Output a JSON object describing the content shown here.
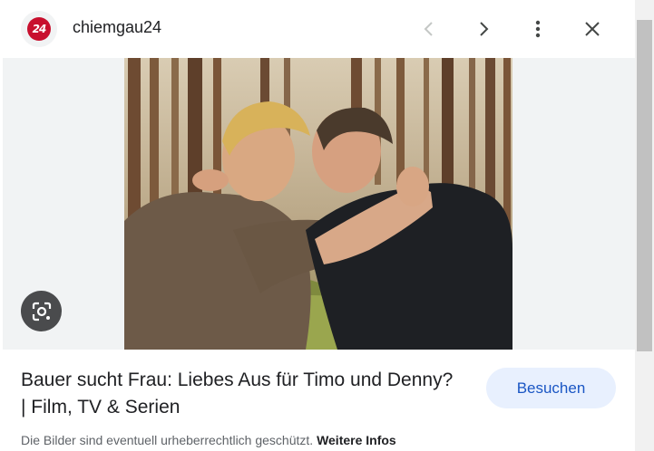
{
  "header": {
    "logo_text": "24",
    "site_name": "chiemgau24",
    "prev_icon": "chevron-left-icon",
    "next_icon": "chevron-right-icon",
    "more_icon": "more-vert-icon",
    "close_icon": "close-icon"
  },
  "main": {
    "image_subject": "two men kissing in a pine forest",
    "lens_icon": "google-lens-icon",
    "title": "Bauer sucht Frau: Liebes Aus für Timo und Denny? | Film, TV & Serien",
    "visit_label": "Besuchen",
    "copyright_text": "Die Bilder sind eventuell urheberrechtlich geschützt.",
    "more_info_label": "Weitere Infos"
  },
  "colors": {
    "brand_red": "#c8102e",
    "button_bg": "#e8f0fe",
    "button_text": "#1a56c4"
  }
}
